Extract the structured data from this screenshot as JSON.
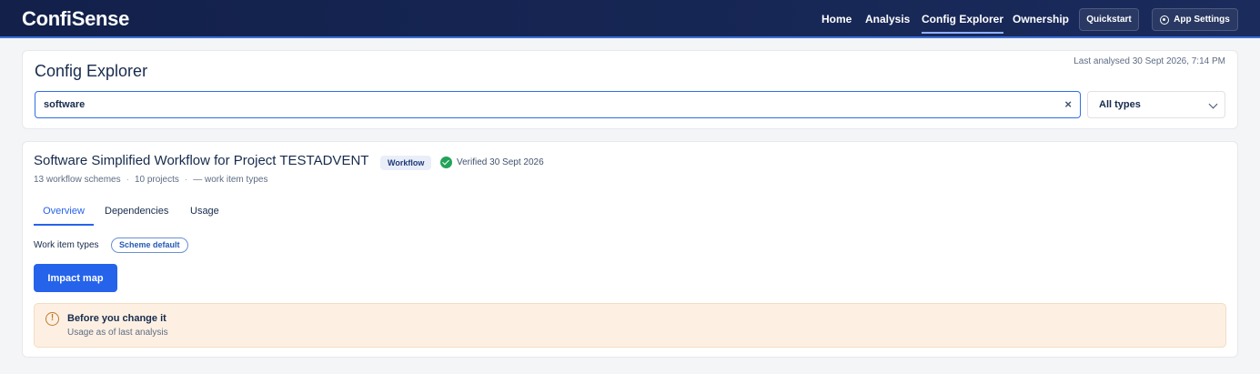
{
  "header": {
    "brand": "ConfiSense",
    "nav": {
      "home": "Home",
      "analysis": "Analysis",
      "config_explorer": "Config Explorer",
      "ownership": "Ownership"
    },
    "active_nav": "Config Explorer",
    "quickstart_label": "Quickstart",
    "app_settings_label": "App Settings"
  },
  "explorer": {
    "title": "Config Explorer",
    "last_analysed": "Last analysed 30 Sept 2026, 7:14 PM",
    "search": {
      "value": "software",
      "clear_icon": "×"
    },
    "type_filter": {
      "selected": "All types"
    }
  },
  "result": {
    "title": "Software Simplified Workflow for Project TESTADVENT",
    "badge": "Workflow",
    "verified": "Verified 30 Sept 2026",
    "meta": {
      "schemes": "13 workflow schemes",
      "projects": "10 projects",
      "work_item_types": "— work item types",
      "separator": "·"
    },
    "tabs": [
      "Overview",
      "Dependencies",
      "Usage"
    ],
    "active_tab": "Overview",
    "work_item_types_label": "Work item types",
    "work_item_types_chip": "Scheme default",
    "impact_map_label": "Impact map",
    "warning": {
      "icon": "!",
      "title": "Before you change it",
      "subtitle": "Usage as of last analysis"
    }
  },
  "colors": {
    "header_bg": "#12204a",
    "accent": "#2563eb",
    "success": "#22a35a",
    "warning_bg": "#fdf0e3"
  }
}
